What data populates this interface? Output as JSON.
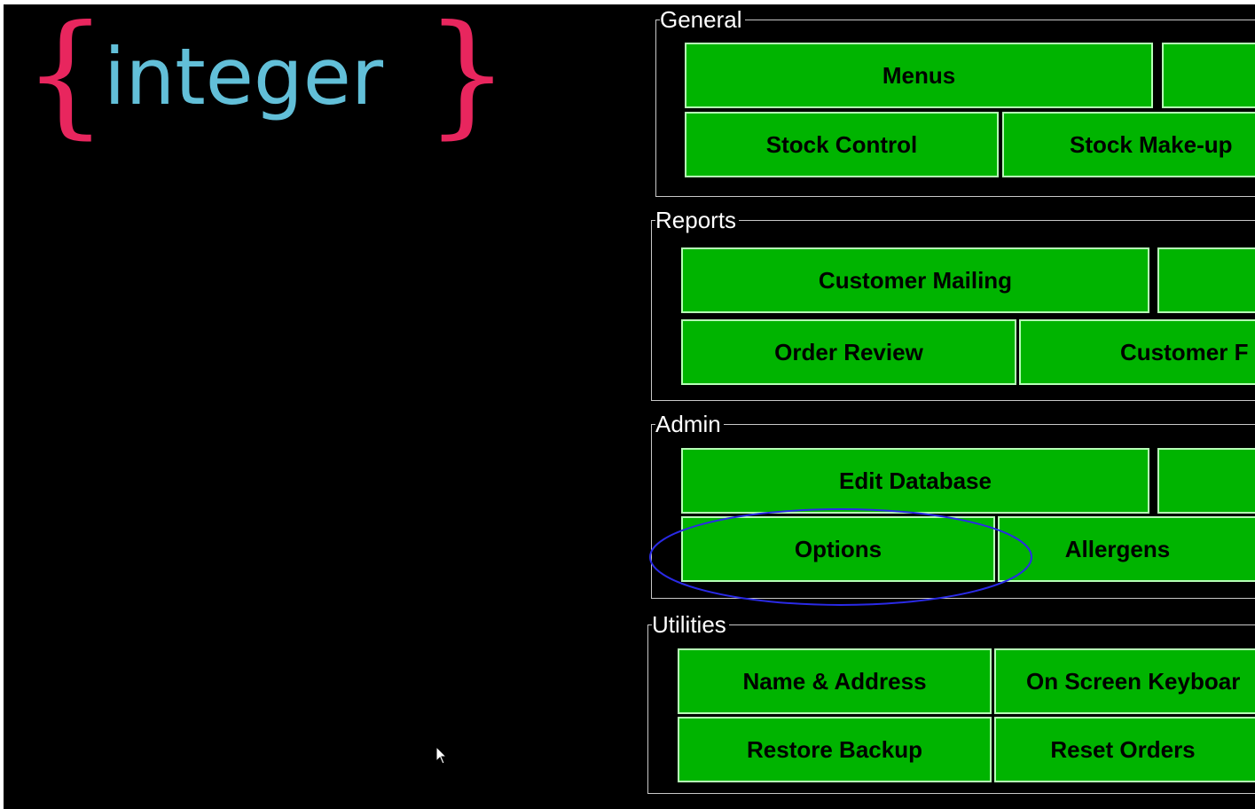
{
  "logo": {
    "brace_open": "{",
    "word": "integer",
    "brace_close": "}",
    "colors": {
      "brace": "#e8265e",
      "word": "#62bfd8"
    }
  },
  "groups": {
    "general": {
      "title": "General",
      "buttons": {
        "menus": "Menus",
        "stock_control": "Stock Control",
        "stock_makeup": "Stock Make-up"
      }
    },
    "reports": {
      "title": "Reports",
      "buttons": {
        "customer_mailing": "Customer Mailing",
        "order_review": "Order Review",
        "customer_partial": "Customer F"
      }
    },
    "admin": {
      "title": "Admin",
      "buttons": {
        "edit_database": "Edit Database",
        "options": "Options",
        "allergens": "Allergens"
      }
    },
    "utilities": {
      "title": "Utilities",
      "buttons": {
        "name_address": "Name & Address",
        "on_screen_keyboard": "On Screen Keyboar",
        "restore_backup": "Restore Backup",
        "reset_orders": "Reset Orders"
      }
    }
  },
  "annotation": {
    "shape": "ellipse",
    "color": "#2a2ae6",
    "target": "Options"
  },
  "colors": {
    "background": "#000000",
    "button": "#00b400",
    "button_border": "#b6ffb6",
    "group_border": "#c8c8c8"
  },
  "cursor": {
    "icon": "mouse-pointer-icon"
  }
}
